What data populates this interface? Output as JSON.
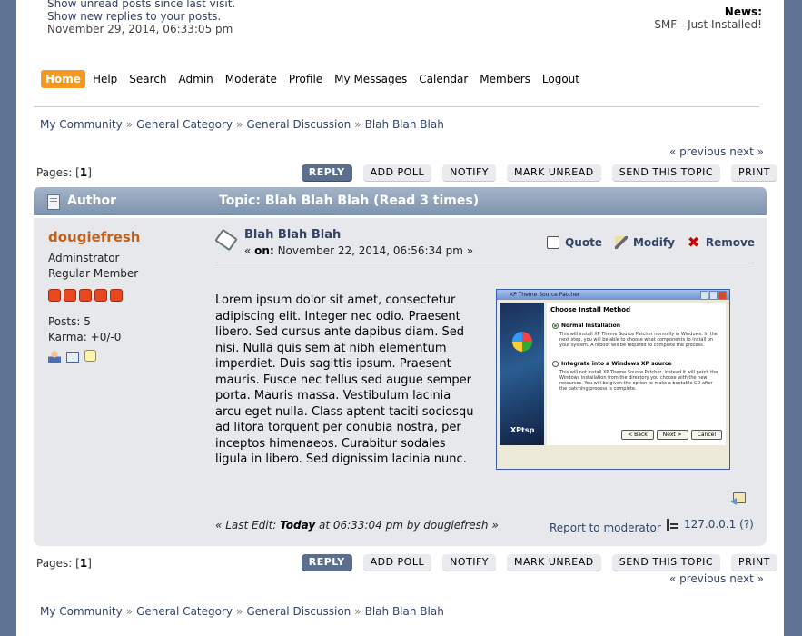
{
  "header": {
    "unread_link": "Show unread posts since last visit.",
    "replies_link": "Show new replies to your posts.",
    "datetime": "November 29, 2014, 06:33:05 pm",
    "news_title": "News:",
    "news_text": "SMF - Just Installed!"
  },
  "menu": [
    "Home",
    "Help",
    "Search",
    "Admin",
    "Moderate",
    "Profile",
    "My Messages",
    "Calendar",
    "Members",
    "Logout"
  ],
  "breadcrumb": [
    "My Community",
    "General Category",
    "General Discussion",
    "Blah Blah Blah"
  ],
  "breadcrumb_sep": "»",
  "pagenav": {
    "previous": "« previous",
    "next": "next »"
  },
  "pages": {
    "label": "Pages:",
    "current": "1"
  },
  "buttons": [
    "REPLY",
    "ADD POLL",
    "NOTIFY",
    "MARK UNREAD",
    "SEND THIS TOPIC",
    "PRINT"
  ],
  "catbar": {
    "author": "Author",
    "topic": "Topic: Blah Blah Blah  (Read 3 times)"
  },
  "poster": {
    "name": "dougiefresh",
    "title": "Adminstrator",
    "group": "Regular Member",
    "stars": 5,
    "posts": "Posts: 5",
    "karma": "Karma: +0/-0"
  },
  "message": {
    "subject": "Blah Blah Blah",
    "on_label": "on:",
    "date": "November 22, 2014, 06:56:34 pm",
    "quote": "Quote",
    "modify": "Modify",
    "remove": "Remove",
    "body": "Lorem ipsum dolor sit amet, consectetur adipiscing elit. Integer nec odio. Praesent libero. Sed cursus ante dapibus diam. Sed nisi. Nulla quis sem at nibh elementum imperdiet. Duis sagittis ipsum. Praesent mauris. Fusce nec tellus sed augue semper porta. Mauris massa. Vestibulum lacinia arcu eget nulla. Class aptent taciti sociosqu ad litora torquent per conubia nostra, per inceptos himenaeos. Curabitur sodales ligula in libero. Sed dignissim lacinia nunc.",
    "last_edit_prefix": "« Last Edit:",
    "last_edit_when": "Today",
    "last_edit_rest": "at 06:33:04 pm by dougiefresh »",
    "report": "Report to moderator",
    "ip": "127.0.0.1 (?)"
  },
  "attachment": {
    "window_title": "XP Theme Source Patcher",
    "heading": "Choose Install Method",
    "option1": "Normal Installation",
    "option1_desc": "This will install XP Theme Source Patcher normally in Windows. In the next step, you will be able to choose what components to install on your system. A reboot will be required to complete the process.",
    "option2": "Integrate into a Windows XP source",
    "option2_desc": "This will not install XP Theme Source Patcher, instead it will patch the Windows installation from the directory you choose with the new resources. You will be given the option to make a bootable CD after the patching process is complete.",
    "brand": "XPtsp",
    "btn_back": "< Back",
    "btn_next": "Next >",
    "btn_cancel": "Cancel"
  }
}
